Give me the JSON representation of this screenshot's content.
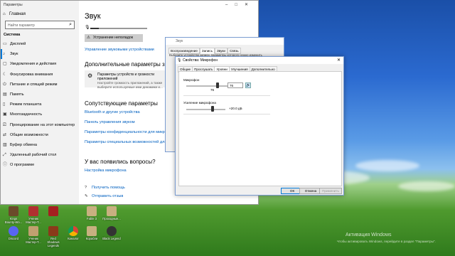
{
  "settings": {
    "title": "Параметры",
    "home": "Главная",
    "search_placeholder": "Найти параметр",
    "group": "Система",
    "nav": [
      {
        "label": "Дисплей",
        "icon": "monitor-icon"
      },
      {
        "label": "Звук",
        "icon": "speaker-icon"
      },
      {
        "label": "Уведомления и действия",
        "icon": "notification-icon"
      },
      {
        "label": "Фокусировка внимания",
        "icon": "moon-icon"
      },
      {
        "label": "Питание и спящий режим",
        "icon": "power-icon"
      },
      {
        "label": "Память",
        "icon": "storage-icon"
      },
      {
        "label": "Режим планшета",
        "icon": "tablet-icon"
      },
      {
        "label": "Многозадачность",
        "icon": "multitask-icon"
      },
      {
        "label": "Проецирование на этот компьютер",
        "icon": "project-icon"
      },
      {
        "label": "Общие возможности",
        "icon": "share-icon"
      },
      {
        "label": "Буфер обмена",
        "icon": "clipboard-icon"
      },
      {
        "label": "Удаленный рабочий стол",
        "icon": "remote-icon"
      },
      {
        "label": "О программе",
        "icon": "info-icon"
      }
    ],
    "selected_index": 1,
    "main": {
      "heading": "Звук",
      "volume_level": 0.15,
      "troubleshoot": "Устранение неполадок",
      "manage_devices": "Управление звуковыми устройствами",
      "advanced_heading": "Дополнительные параметры звука",
      "card_title": "Параметры устройств и громкости приложений",
      "card_line1": "Настройте громкость приложений, а также",
      "card_line2": "выберите используемые ими динамики и...",
      "related_heading": "Сопутствующие параметры",
      "related_links": [
        "Bluetooth и другие устройства",
        "Панель управления звуком",
        "Параметры конфиденциальности для микрофона",
        "Параметры специальных возможностей для ауди..."
      ],
      "questions_heading": "У вас появились вопросы?",
      "questions_link": "Настройка микрофона",
      "help_link": "Получить помощь",
      "feedback_link": "Отправить отзыв"
    }
  },
  "sound_dialog": {
    "title": "Звук",
    "tabs": [
      "Воспроизведение",
      "Запись",
      "Звуки",
      "Связь"
    ],
    "active_tab": 1,
    "description": "Выберите устройство записи, параметры которого нужно изменить"
  },
  "mic_dialog": {
    "title": "Свойства: Микрофон",
    "tabs": [
      "Общие",
      "Прослушать",
      "Уровни",
      "Улучшения",
      "Дополнительно"
    ],
    "active_tab": 2,
    "mic_label": "Микрофон",
    "mic_value": "76",
    "mic_fraction": 0.76,
    "boost_label": "Усиление микрофона",
    "boost_value": "+20.0 дБ",
    "boost_fraction": 0.67,
    "ok": "ОК",
    "cancel": "Отмена",
    "apply": "Применить"
  },
  "desktop": {
    "icons_row1": [
      "Kings Bounty-Wo...",
      "Ученик Мастер-Т...",
      "",
      "Fable 3",
      "Проходные..."
    ],
    "icons_row2": [
      "Discord",
      "Ученик Мастер-Т...",
      "Red Shadows Legends",
      "Каналог",
      "Корабли",
      "Black Legend"
    ],
    "activation_title": "Активация Windows",
    "activation_sub": "Чтобы активировать Windows, перейдите в раздел \"Параметры\"."
  }
}
